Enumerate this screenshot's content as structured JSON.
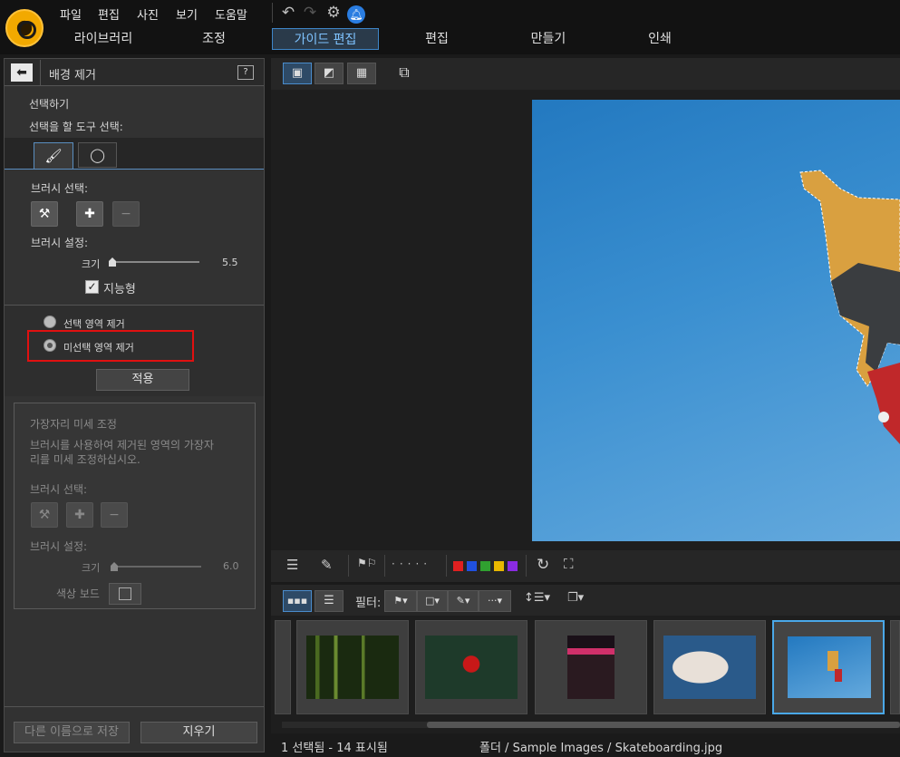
{
  "menu": [
    "파일",
    "편집",
    "사진",
    "보기",
    "도움말"
  ],
  "modules": [
    "라이브러리",
    "조정",
    "가이드 편집",
    "편집",
    "만들기",
    "인쇄"
  ],
  "panel": {
    "title": "배경 제거",
    "select_header": "선택하기",
    "select_tool_prompt": "선택을 할 도구 선택:",
    "brush_select_label": "브러시 선택:",
    "brush_settings_label": "브러시 설정:",
    "size_label": "크기",
    "size_value": "5.5",
    "smart_label": "지능형",
    "remove_selected": "선택 영역 제거",
    "remove_unselected": "미선택 영역 제거",
    "apply_label": "적용",
    "refine_title": "가장자리 미세 조정",
    "refine_desc_1": "브러시를 사용하여 제거된 영역의 가장자",
    "refine_desc_2": "리를 미세 조정하십시오.",
    "refine_brush_select": "브러시 선택:",
    "refine_brush_settings": "브러시 설정:",
    "refine_size_label": "크기",
    "refine_size_value": "6.0",
    "color_board_label": "색상 보드",
    "save_as_label": "다른 이름으로 저장",
    "clear_label": "지우기"
  },
  "filter_label": "필터:",
  "color_labels": [
    "#e02020",
    "#2050e0",
    "#30a030",
    "#e8b800",
    "#8a2be2"
  ],
  "status": {
    "selection": "1 선택됨 - 14 표시됨",
    "path": "폴더 / Sample Images / Skateboarding.jpg"
  },
  "accent": "#3e86c8",
  "highlight_box_color": "#e01010"
}
